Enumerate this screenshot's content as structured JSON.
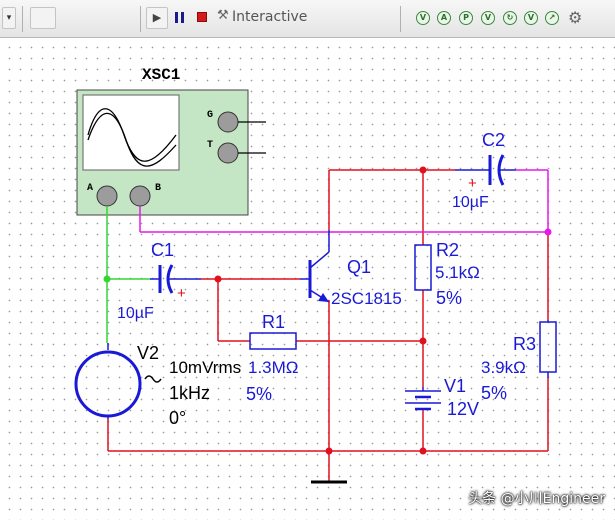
{
  "toolbar": {
    "mode_label": "Interactive",
    "icons": [
      "play-icon",
      "pause-icon",
      "stop-icon",
      "probe-icon",
      "grapher-icon",
      "postprocessor-icon",
      "analysis-icon",
      "settings-icon"
    ],
    "accent_colors": {
      "pause": "#1a1a8c",
      "stop": "#d41a1a",
      "sim_icons": "#3a8a3a"
    }
  },
  "scope": {
    "ref": "XSC1",
    "ch_a": "A",
    "ch_b": "B",
    "ground": "G",
    "trigger": "T"
  },
  "components": {
    "c1": {
      "ref": "C1",
      "value": "10µF"
    },
    "c2": {
      "ref": "C2",
      "value": "10µF"
    },
    "r1": {
      "ref": "R1",
      "value": "1.3MΩ",
      "tol": "5%"
    },
    "r2": {
      "ref": "R2",
      "value": "5.1kΩ",
      "tol": "5%"
    },
    "r3": {
      "ref": "R3",
      "value": "3.9kΩ",
      "tol": "5%"
    },
    "q1": {
      "ref": "Q1",
      "model": "2SC1815"
    },
    "v1": {
      "ref": "V1",
      "value": "12V"
    },
    "v2": {
      "ref": "V2",
      "amp": "10mVrms",
      "freq": "1kHz",
      "phase": "0°"
    }
  },
  "wire_colors": {
    "main": "#e0101e",
    "scope_a": "#33d633",
    "scope_b": "#e619e6",
    "component": "#1a1ad6"
  },
  "watermark": "头条 @小川Engineer"
}
